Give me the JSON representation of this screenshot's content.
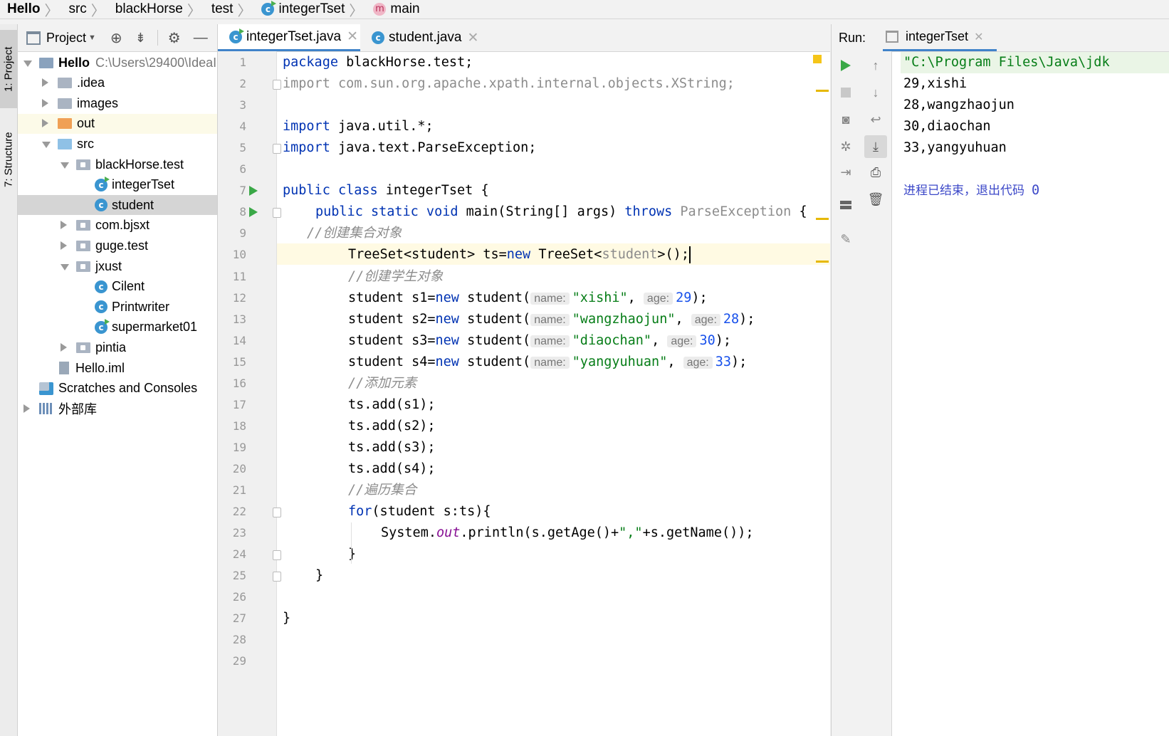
{
  "breadcrumb": {
    "items": [
      "Hello",
      "src",
      "blackHorse",
      "test",
      "integerTset",
      "main"
    ]
  },
  "left_strip": {
    "project_tab": "1: Project",
    "structure_tab": "7: Structure"
  },
  "project_panel": {
    "title": "Project",
    "tree": [
      {
        "label": "Hello",
        "extra": "C:\\Users\\29400\\IdeaI",
        "bold": true,
        "arrow": "down",
        "icon": "module-folder"
      },
      {
        "label": ".idea",
        "arrow": "right",
        "icon": "folder"
      },
      {
        "label": "images",
        "arrow": "right",
        "icon": "folder"
      },
      {
        "label": "out",
        "arrow": "right",
        "icon": "folder-orange"
      },
      {
        "label": "src",
        "arrow": "down",
        "icon": "folder-blue"
      },
      {
        "label": "blackHorse.test",
        "arrow": "down",
        "icon": "package"
      },
      {
        "label": "integerTset",
        "icon": "class-run"
      },
      {
        "label": "student",
        "icon": "class",
        "selected": true
      },
      {
        "label": "com.bjsxt",
        "arrow": "right",
        "icon": "package"
      },
      {
        "label": "guge.test",
        "arrow": "right",
        "icon": "package"
      },
      {
        "label": "jxust",
        "arrow": "down",
        "icon": "package"
      },
      {
        "label": "Cilent",
        "icon": "class"
      },
      {
        "label": "Printwriter",
        "icon": "class"
      },
      {
        "label": "supermarket01",
        "icon": "class-run"
      },
      {
        "label": "pintia",
        "arrow": "right",
        "icon": "package"
      },
      {
        "label": "Hello.iml",
        "icon": "iml-file"
      },
      {
        "label": "Scratches and Consoles",
        "icon": "scratches"
      },
      {
        "label": "外部库",
        "arrow": "right",
        "icon": "library"
      }
    ]
  },
  "editor": {
    "tabs": [
      {
        "label": "integerTset.java",
        "active": true
      },
      {
        "label": "student.java",
        "active": false
      }
    ],
    "line_numbers": [
      "1",
      "2",
      "3",
      "4",
      "5",
      "6",
      "7",
      "8",
      "9",
      "10",
      "11",
      "12",
      "13",
      "14",
      "15",
      "16",
      "17",
      "18",
      "19",
      "20",
      "21",
      "22",
      "23",
      "24",
      "25",
      "26",
      "27",
      "28",
      "29"
    ],
    "code": {
      "l1_kw": "package",
      "l1_rest": " blackHorse.test;",
      "l2": "import com.sun.org.apache.xpath.internal.objects.XString;",
      "l4_kw": "import",
      "l4_rest": " java.util.*;",
      "l5_kw": "import",
      "l5_rest": " java.text.ParseException;",
      "l7_kw": "public class",
      "l7_rest": " integerTset {",
      "l8_kw1": "public static void",
      "l8_fn": "main",
      "l8_a": "(String[] args) ",
      "l8_kw2": "throws",
      "l8_ex": "ParseException",
      "l8_b": " {",
      "l9": "//创建集合对象",
      "l10_a": "TreeSet<student> ts=",
      "l10_kw": "new",
      "l10_b": " TreeSet<",
      "l10_g": "student",
      "l10_c": ">();",
      "l11": "//创建学生对象",
      "hint_name": "name:",
      "hint_age": "age:",
      "students": [
        {
          "var": "student s1=",
          "name": "\"xishi\"",
          "age": "29"
        },
        {
          "var": "student s2=",
          "name": "\"wangzhaojun\"",
          "age": "28"
        },
        {
          "var": "student s3=",
          "name": "\"diaochan\"",
          "age": "30"
        },
        {
          "var": "student s4=",
          "name": "\"yangyuhuan\"",
          "age": "33"
        }
      ],
      "new_kw": "new",
      "ctor": " student(",
      "comma": ", ",
      "close": ");",
      "l16": "//添加元素",
      "adds": [
        "ts.add(s1);",
        "ts.add(s2);",
        "ts.add(s3);",
        "ts.add(s4);"
      ],
      "l21": "//遍历集合",
      "l22_kw": "for",
      "l22_rest": "(student s:ts){",
      "l23_a": "System.",
      "l23_out": "out",
      "l23_b": ".println(s.getAge()+",
      "l23_str": "\",\"",
      "l23_c": "+s.getName());",
      "brace": "}"
    }
  },
  "run_panel": {
    "label": "Run:",
    "tab": "integerTset",
    "output": [
      "\"C:\\Program Files\\Java\\jdk",
      "29,xishi",
      "28,wangzhaojun",
      "30,diaochan",
      "33,yangyuhuan"
    ],
    "exit_text": "进程已结束，退出代码",
    "exit_code": "0"
  },
  "colors": {
    "keyword": "#0033b3",
    "string": "#067d17",
    "number": "#1750eb",
    "comment": "#8c8c8c",
    "selected_row": "#d5d5d5",
    "highlight_row": "#fffae3",
    "exit_text": "#3c48c8"
  }
}
